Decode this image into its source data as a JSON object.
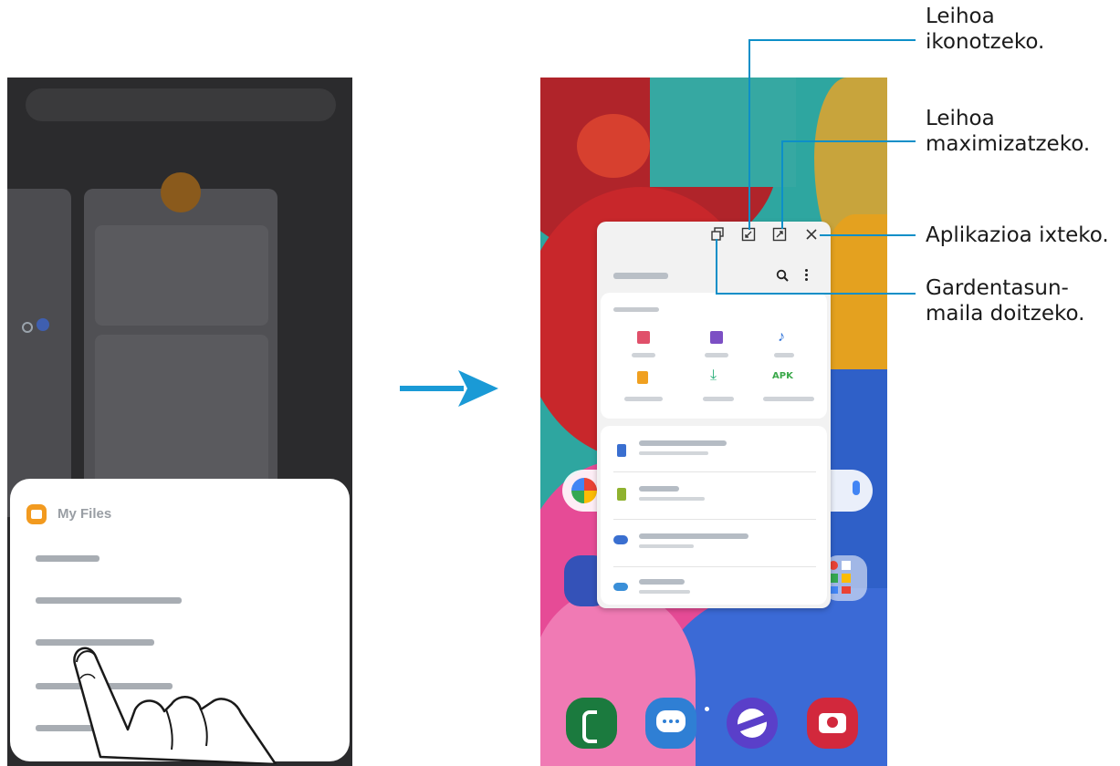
{
  "left_phone": {
    "popup": {
      "title": "My Files"
    }
  },
  "right_phone": {
    "window_toolbar_icons": [
      "opacity-icon",
      "minimize-icon",
      "maximize-icon",
      "close-icon"
    ]
  },
  "callouts": {
    "minimize": [
      "Leihoa",
      "ikonotzeko."
    ],
    "maximize": [
      "Leihoa",
      "maximizatzeko."
    ],
    "close": [
      "Aplikazioa ixteko."
    ],
    "opacity": [
      "Gardentasun-",
      "maila doitzeko."
    ]
  },
  "colors": {
    "callout_line": "#0d8fc8",
    "arrow": "#1a9ad6",
    "popup_accent": "#f29a1f"
  }
}
